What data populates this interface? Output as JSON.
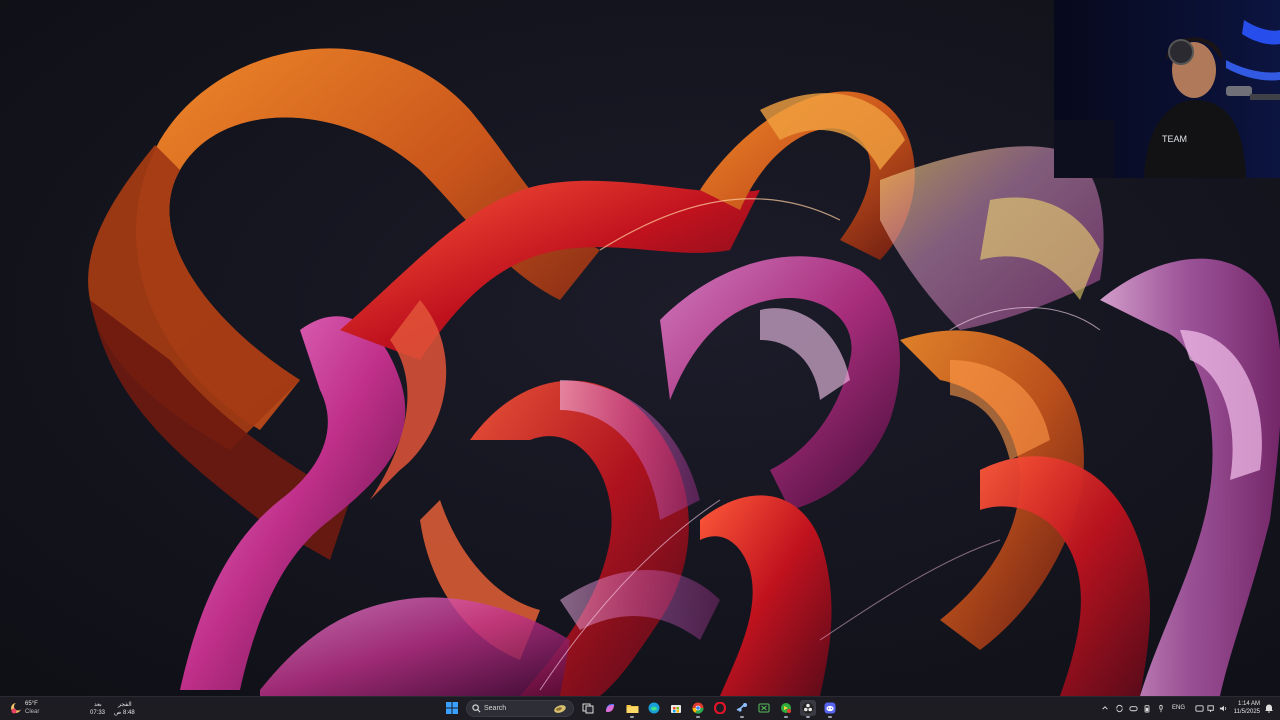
{
  "weather": {
    "temperature": "65°F",
    "condition": "Clear",
    "icon": "weather-moon-icon"
  },
  "prayer": {
    "name": "الفجر",
    "time": "8:48",
    "period": "ص",
    "remaining_label": "بعد",
    "remaining": "07:33"
  },
  "search": {
    "placeholder": "Search"
  },
  "taskbar_apps": [
    {
      "name": "start",
      "icon": "windows-logo-icon"
    },
    {
      "name": "task-view",
      "icon": "task-view-icon"
    },
    {
      "name": "copilot",
      "icon": "copilot-icon"
    },
    {
      "name": "file-explorer",
      "icon": "folder-icon"
    },
    {
      "name": "edge",
      "icon": "edge-icon"
    },
    {
      "name": "microsoft-store",
      "icon": "store-icon"
    },
    {
      "name": "chrome",
      "icon": "chrome-icon"
    },
    {
      "name": "opera",
      "icon": "opera-icon"
    },
    {
      "name": "steam",
      "icon": "steam-icon"
    },
    {
      "name": "xbox",
      "icon": "xbox-icon"
    },
    {
      "name": "game-app",
      "icon": "game-app-icon"
    },
    {
      "name": "obs",
      "icon": "obs-icon"
    },
    {
      "name": "discord",
      "icon": "discord-icon"
    }
  ],
  "tray": {
    "language": "ENG",
    "time": "1:14 AM",
    "date": "11/5/2025",
    "icons": [
      "chevron-up-icon",
      "sync-icon",
      "gamepad-icon",
      "battery-icon",
      "mic-icon",
      "speaker-icon",
      "network-icon",
      "volume-icon",
      "notification-bell-icon"
    ]
  },
  "colors": {
    "taskbar": "#1c1c22",
    "wallpaper_bg": "#161621",
    "accent_orange": "#e0641e",
    "accent_magenta": "#c0308a",
    "accent_red": "#b8141e"
  }
}
